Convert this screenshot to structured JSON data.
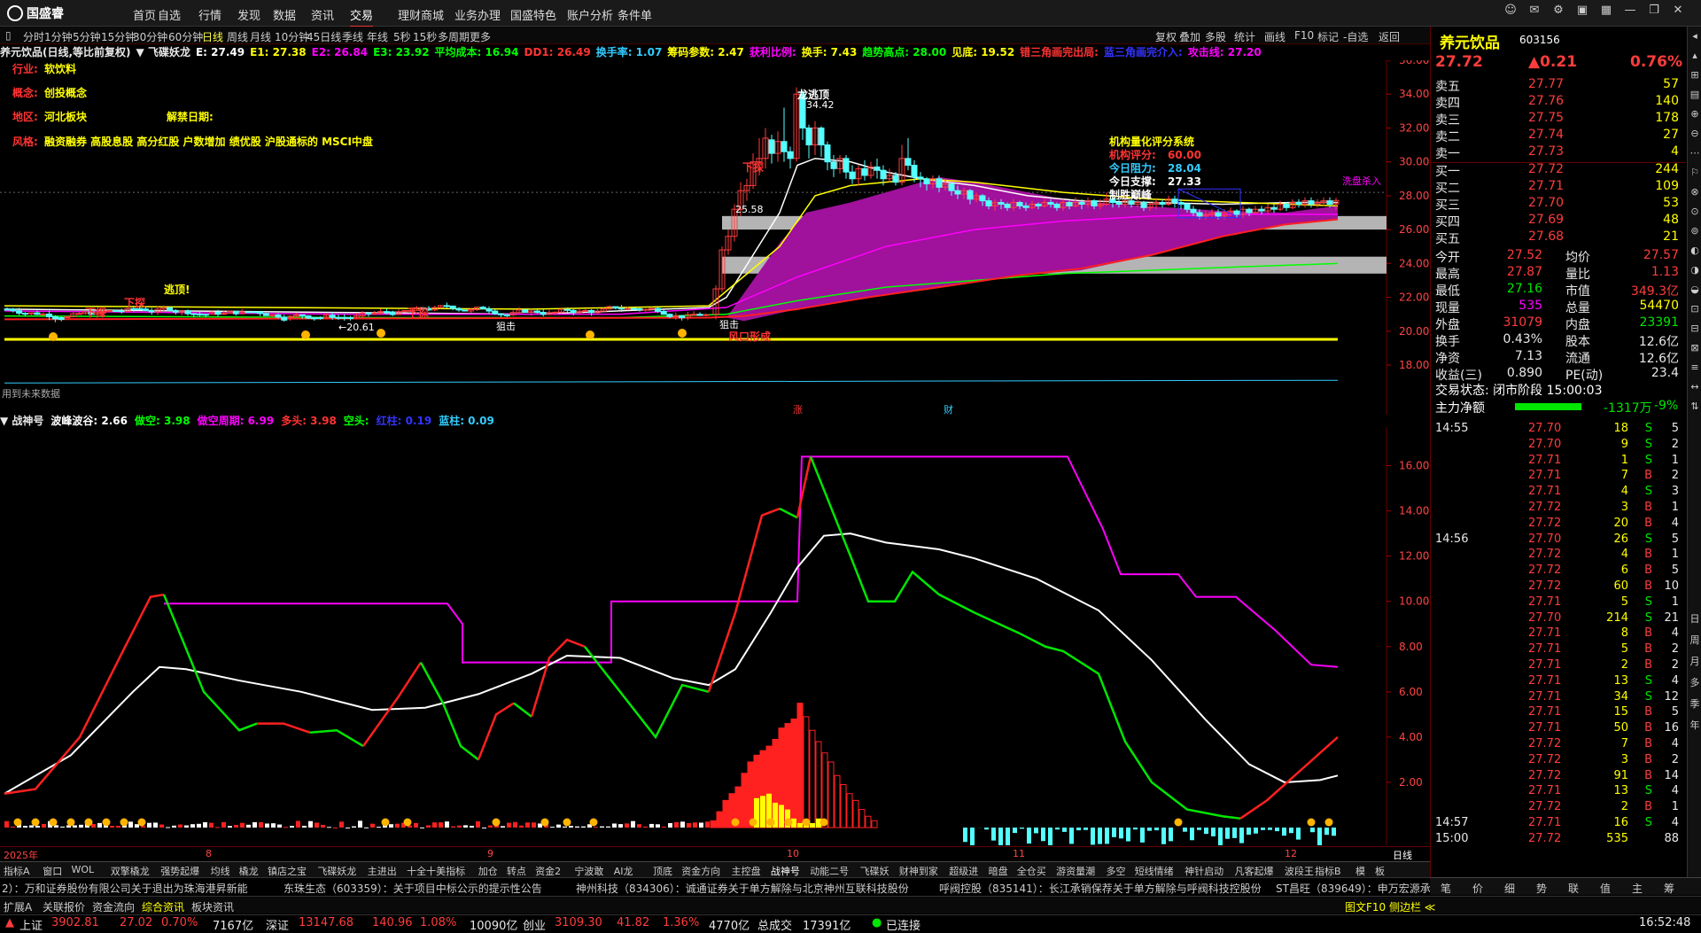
{
  "app": {
    "logo": "国盛睿"
  },
  "menu": [
    "首页",
    "自选",
    "行情",
    "发现",
    "数据",
    "资讯",
    "交易",
    "理财商城",
    "业务办理",
    "国盛特色",
    "账户分析",
    "条件单"
  ],
  "menu_selected": "交易",
  "periods": [
    "分时",
    "1分钟",
    "5分钟",
    "15分钟",
    "30分钟",
    "60分钟",
    "日线",
    "周线",
    "月线",
    "10分钟",
    "45日线",
    "季线",
    "年线",
    "5秒",
    "15秒",
    "多周期",
    "更多"
  ],
  "period_selected": "日线",
  "toolbar": [
    "复权",
    "叠加",
    "多股",
    "统计",
    "画线",
    "F10",
    "标记",
    "-自选",
    "返回"
  ],
  "legend_top": [
    {
      "t": "养元饮品(日线,等比前复权)",
      "c": "#e8e8e8"
    },
    {
      "t": "▼ 飞碟妖龙",
      "c": "#e8e8e8"
    },
    {
      "t": "E: 27.49",
      "c": "#fff"
    },
    {
      "t": "E1: 27.38",
      "c": "#ff0"
    },
    {
      "t": "E2: 26.84",
      "c": "#f0f"
    },
    {
      "t": "E3: 23.92",
      "c": "#0f0"
    },
    {
      "t": "平均成本: 16.94",
      "c": "#0f0"
    },
    {
      "t": "DD1: 26.49",
      "c": "#f33"
    },
    {
      "t": "换手率: 1.07",
      "c": "#3cf"
    },
    {
      "t": "筹码参数: 2.47",
      "c": "#ff0"
    },
    {
      "t": "获利比例:",
      "c": "#f0f"
    },
    {
      "t": "换手: 7.43",
      "c": "#ff0"
    },
    {
      "t": "趋势高点: 28.00",
      "c": "#0f0"
    },
    {
      "t": "见底: 19.52",
      "c": "#ff0"
    },
    {
      "t": "错三角画完出局:",
      "c": "#f33"
    },
    {
      "t": "蓝三角画完介入:",
      "c": "#33f"
    },
    {
      "t": "攻击线: 27.20",
      "c": "#f0f"
    }
  ],
  "info_lines": [
    {
      "k": "行业:",
      "v": "软饮料"
    },
    {
      "k": "概念:",
      "v": "创投概念"
    },
    {
      "k": "地区:",
      "v": "河北板块",
      "k2": "解禁日期:"
    },
    {
      "k": "风格:",
      "v": "融资融券 高股息股 高分红股 户数增加 绩优股 沪股通标的 MSCI中盘"
    }
  ],
  "eval": {
    "title": "机构量化评分系统",
    "score_label": "机构评分:",
    "score": "60.00",
    "res_label": "今日阻力:",
    "res": "28.04",
    "sup_label": "今日支撑:",
    "sup": "27.33",
    "tag": "制胜巅峰"
  },
  "annotations": {
    "dragon": "龙逃顶",
    "peak": "34.42",
    "escape": "逃顶!",
    "xiatan": "下探",
    "attack": "狙击",
    "fengkou": "风口形成",
    "val2558": "25.58",
    "val2061": "←20.61",
    "washout": "洗盘杀入",
    "future": "用到未来数据",
    "bottom_labels": [
      "涨",
      "财"
    ]
  },
  "main_yaxis": [
    "36.00",
    "34.00",
    "32.00",
    "30.00",
    "28.00",
    "26.00",
    "24.00",
    "22.00",
    "20.00",
    "18.00"
  ],
  "sub_legend": [
    {
      "t": "▼ 战神号",
      "c": "#e8e8e8"
    },
    {
      "t": "波峰波谷: 2.66",
      "c": "#fff"
    },
    {
      "t": "做空: 3.98",
      "c": "#0f0"
    },
    {
      "t": "做空周期: 6.99",
      "c": "#f0f"
    },
    {
      "t": "多头: 3.98",
      "c": "#f33"
    },
    {
      "t": "空头:",
      "c": "#0f0"
    },
    {
      "t": "红柱: 0.19",
      "c": "#33f"
    },
    {
      "t": "蓝柱: 0.09",
      "c": "#3cf"
    }
  ],
  "sub_yaxis": [
    "16.00",
    "14.00",
    "12.00",
    "10.00",
    "8.00",
    "6.00",
    "4.00",
    "2.00"
  ],
  "xaxis": [
    "2025年",
    "8",
    "9",
    "10",
    "11",
    "12"
  ],
  "xaxis_right": "日线",
  "tabs": [
    "指标A",
    "窗口",
    "WOL",
    "双擎橇龙",
    "强势起爆",
    "均线",
    "橇龙",
    "镇店之宝",
    "飞碟妖龙",
    "主进出",
    "十全十美指标",
    "加仓",
    "转点",
    "资金2",
    "宁波敢",
    "AI龙",
    "顶底",
    "资金方向",
    "主控盘",
    "战神号",
    "动能二号",
    "飞碟妖",
    "财神到家",
    "超级进",
    "暗盘",
    "全仓买",
    "游资量潮",
    "多空",
    "短线情绪",
    "神针启动",
    "凡客起爆",
    "波段王"
  ],
  "tab_selected": "战神号",
  "tabs_right": [
    "指标B",
    "模",
    "板"
  ],
  "quote": {
    "name": "养元饮品",
    "code": "603156",
    "price": "27.72",
    "change": "▲0.21",
    "pct": "0.76%",
    "asks": [
      [
        "卖五",
        "27.77",
        "57"
      ],
      [
        "卖四",
        "27.76",
        "140"
      ],
      [
        "卖三",
        "27.75",
        "178"
      ],
      [
        "卖二",
        "27.74",
        "27"
      ],
      [
        "卖一",
        "27.73",
        "4"
      ]
    ],
    "bids": [
      [
        "买一",
        "27.72",
        "244"
      ],
      [
        "买二",
        "27.71",
        "109"
      ],
      [
        "买三",
        "27.70",
        "53"
      ],
      [
        "买四",
        "27.69",
        "48"
      ],
      [
        "买五",
        "27.68",
        "21"
      ]
    ],
    "stats": [
      [
        "今开",
        "27.52",
        "均价",
        "27.57"
      ],
      [
        "最高",
        "27.87",
        "量比",
        "1.13"
      ],
      [
        "最低",
        "27.16",
        "市值",
        "349.3亿"
      ],
      [
        "现量",
        "535",
        "总量",
        "54470"
      ],
      [
        "外盘",
        "31079",
        "内盘",
        "23391"
      ],
      [
        "换手",
        "0.43%",
        "股本",
        "12.6亿"
      ],
      [
        "净资",
        "7.13",
        "流通",
        "12.6亿"
      ],
      [
        "收益(三)",
        "0.890",
        "PE(动)",
        "23.4"
      ]
    ],
    "trade_state": "交易状态: 闭市阶段 15:00:03",
    "main_flow_label": "主力净额",
    "main_flow": "-1317万",
    "main_flow_pct": "-9%"
  },
  "ticks": [
    [
      "14:55",
      "27.70",
      "18",
      "S",
      "5"
    ],
    [
      "",
      "27.70",
      "9",
      "S",
      "2"
    ],
    [
      "",
      "27.71",
      "1",
      "S",
      "1"
    ],
    [
      "",
      "27.71",
      "7",
      "B",
      "2"
    ],
    [
      "",
      "27.71",
      "4",
      "S",
      "3"
    ],
    [
      "",
      "27.72",
      "3",
      "B",
      "1"
    ],
    [
      "",
      "27.72",
      "20",
      "B",
      "4"
    ],
    [
      "14:56",
      "27.70",
      "26",
      "S",
      "5"
    ],
    [
      "",
      "27.72",
      "4",
      "B",
      "1"
    ],
    [
      "",
      "27.72",
      "6",
      "B",
      "5"
    ],
    [
      "",
      "27.72",
      "60",
      "B",
      "10"
    ],
    [
      "",
      "27.71",
      "5",
      "S",
      "1"
    ],
    [
      "",
      "27.70",
      "214",
      "S",
      "21"
    ],
    [
      "",
      "27.71",
      "8",
      "B",
      "4"
    ],
    [
      "",
      "27.71",
      "5",
      "B",
      "2"
    ],
    [
      "",
      "27.71",
      "2",
      "B",
      "2"
    ],
    [
      "",
      "27.71",
      "13",
      "S",
      "4"
    ],
    [
      "",
      "27.71",
      "34",
      "S",
      "12"
    ],
    [
      "",
      "27.71",
      "15",
      "B",
      "5"
    ],
    [
      "",
      "27.71",
      "50",
      "B",
      "16"
    ],
    [
      "",
      "27.72",
      "7",
      "B",
      "4"
    ],
    [
      "",
      "27.72",
      "3",
      "B",
      "2"
    ],
    [
      "",
      "27.72",
      "91",
      "B",
      "14"
    ],
    [
      "",
      "27.71",
      "13",
      "S",
      "4"
    ],
    [
      "",
      "27.72",
      "2",
      "B",
      "1"
    ],
    [
      "14:57",
      "27.71",
      "16",
      "S",
      "4"
    ],
    [
      "15:00",
      "27.72",
      "535",
      "",
      "88"
    ]
  ],
  "right_tabs": [
    "笔",
    "价",
    "细",
    "势",
    "联",
    "值",
    "主",
    "筹"
  ],
  "vstrip": [
    "日",
    "周",
    "月",
    "多",
    "季",
    "年"
  ],
  "news": [
    "2）：万和证券股份有限公司关于退出为珠海港昇新能",
    "东珠生态（603359）：关于项目中标公示的提示性公告",
    "神州科技（834306）：诚通证券关于单方解除与北京神州互联科技股份",
    "呼阀控股（835141）：长江承销保荐关于单方解除与呼阀科技控股份",
    "ST昌旺（839649）：申万宏源承销保荐关于单方解除与昌旺航空（湖北"
  ],
  "newsbar_left": [
    "扩展A",
    "关联报价",
    "资金流向",
    "综合资讯",
    "板块资讯"
  ],
  "newsbar_mid": "图文F10 侧边栏 ≪",
  "status": {
    "sh_label": "上证",
    "sh": "3902.81",
    "sh_ch": "27.02",
    "sh_pct": "0.70%",
    "sh_vol": "7167亿",
    "sz_label": "深证",
    "sz": "13147.68",
    "sz_ch": "140.96",
    "sz_pct": "1.08%",
    "sz_vol": "10090亿",
    "cy_label": "创业",
    "cy": "3109.30",
    "cy_ch": "41.82",
    "cy_pct": "1.36%",
    "cy_vol": "4770亿",
    "total_label": "总成交",
    "total": "17391亿",
    "conn": "已连接",
    "time": "16:52:48"
  },
  "colors": {
    "up": "#ff3c3c",
    "down": "#00e600",
    "accent": "#e33"
  }
}
